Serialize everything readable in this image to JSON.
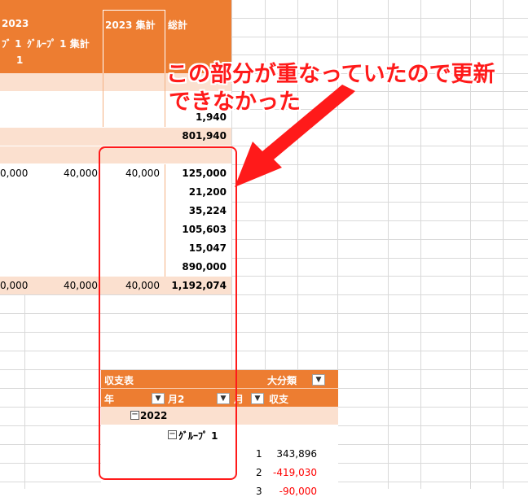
{
  "top_pivot": {
    "header": {
      "year_label": "2023",
      "group_fragment": "ﾌﾞ 1",
      "group_total": "ｸﾞﾙｰﾌﾟ 1 集計",
      "sub_label": "1",
      "year_total": "2023 集計",
      "grand_total": "総計"
    },
    "rows": {
      "r1_total": "1,940",
      "subtotal_1": "801,940",
      "r3_c1": "0,000",
      "r3_c2": "40,000",
      "r3_c3": "40,000",
      "r3_c4": "125,000",
      "r4_c4": "21,200",
      "r5_c4": "35,224",
      "r6_c4": "105,603",
      "r7_c4": "15,047",
      "r8_c4": "890,000",
      "total_c1": "0,000",
      "total_c2": "40,000",
      "total_c3": "40,000",
      "total_c4": "1,192,074"
    }
  },
  "annotation": {
    "line1": "この部分が重なっていたので更新",
    "line2": "できなかった"
  },
  "bottom_pivot": {
    "values_label": "収支表",
    "major_category": "大分類",
    "field_year": "年",
    "field_month2": "月2",
    "field_month": "月",
    "field_income": "収支",
    "year_item": "2022",
    "group_item": "ｸﾞﾙｰﾌﾟ 1",
    "data_rows": [
      {
        "month": "1",
        "value": "343,896",
        "negative": false
      },
      {
        "month": "2",
        "value": "-419,030",
        "negative": true
      },
      {
        "month": "3",
        "value": "-90,000",
        "negative": true
      }
    ]
  },
  "colors": {
    "header_orange": "#ed7d31",
    "row_peach": "#fbe0cf",
    "annotation_red": "#ff1a1a",
    "negative_red": "#ff0000"
  }
}
